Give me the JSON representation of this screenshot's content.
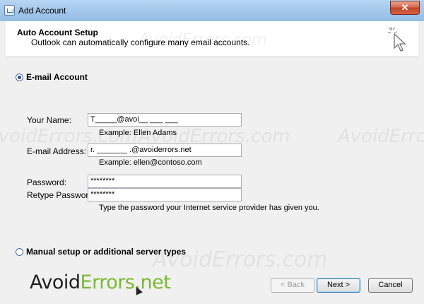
{
  "window": {
    "title": "Add Account",
    "close_glyph": "✕"
  },
  "header": {
    "title": "Auto Account Setup",
    "subtitle": "Outlook can automatically configure many email accounts."
  },
  "options": {
    "email_account_label": "E-mail Account",
    "email_account_selected": true,
    "manual_setup_label": "Manual setup or additional server types",
    "manual_setup_selected": false
  },
  "form": {
    "name_label": "Your Name:",
    "name_value": "T_____@avoi__ ___ ___",
    "name_example": "Example: Ellen Adams",
    "email_label": "E-mail Address:",
    "email_value": "r. _______ .@avoiderrors.net",
    "email_example": "Example: ellen@contoso.com",
    "password_label": "Password:",
    "password_value": "********",
    "retype_label": "Retype Password:",
    "retype_value": "********",
    "password_hint": "Type the password your Internet service provider has given you."
  },
  "buttons": {
    "back": "< Back",
    "next": "Next >",
    "cancel": "Cancel"
  },
  "branding": {
    "logo_part1": "Avoid",
    "logo_part2": "Errors.net",
    "watermark": "AvoidErrors.com",
    "accent_green": "#7ab932"
  },
  "icons": {
    "title_icon": "outlook-window-icon",
    "wizard_icon": "cursor-sparkle-icon"
  }
}
